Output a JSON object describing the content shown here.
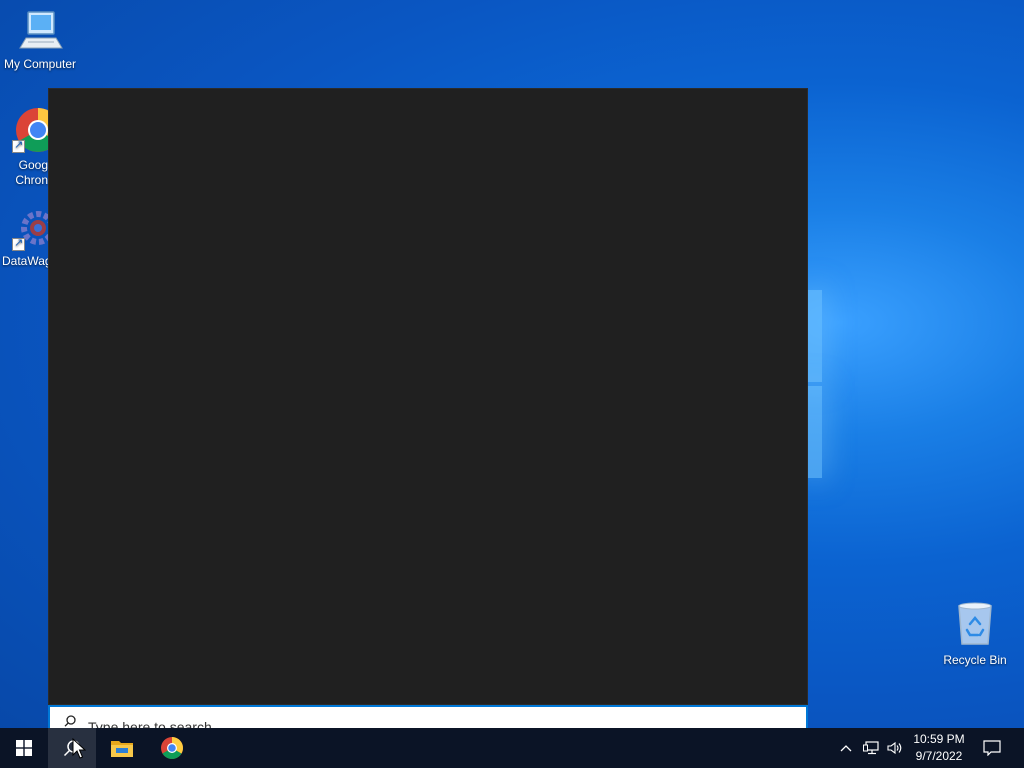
{
  "desktop": {
    "icons": [
      {
        "label": "My Computer"
      },
      {
        "label": "Google Chrome",
        "label_visible": "Goog\nChron"
      },
      {
        "label": "DataWag",
        "label_visible": "DataWag"
      },
      {
        "label": "Recycle Bin"
      }
    ]
  },
  "search": {
    "placeholder": "Type here to search"
  },
  "taskbar": {
    "items": [
      {
        "icon": "windows-start-icon"
      },
      {
        "icon": "search-icon"
      },
      {
        "icon": "file-explorer-icon"
      },
      {
        "icon": "chrome-icon"
      }
    ],
    "tray": {
      "time": "10:59 PM",
      "date": "9/7/2022"
    }
  },
  "colors": {
    "panel_bg": "#202020",
    "taskbar_bg": "#0b1426",
    "accent": "#0078d7"
  }
}
